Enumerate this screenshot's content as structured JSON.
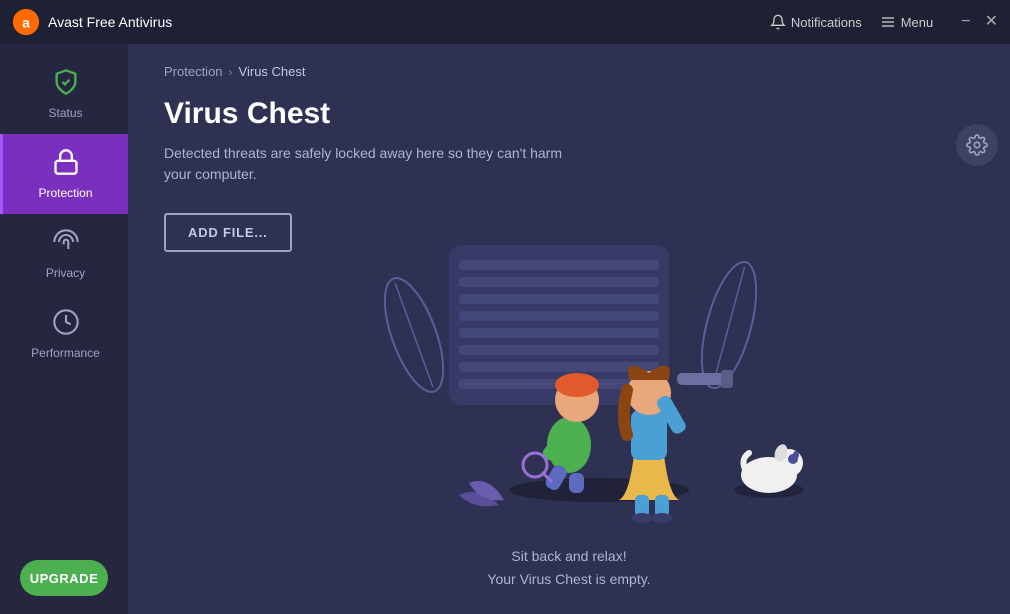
{
  "titleBar": {
    "appName": "Avast Free Antivirus",
    "notifications": "Notifications",
    "menu": "Menu",
    "minimize": "−",
    "close": "✕"
  },
  "sidebar": {
    "items": [
      {
        "id": "status",
        "label": "Status",
        "icon": "shield"
      },
      {
        "id": "protection",
        "label": "Protection",
        "icon": "lock",
        "active": true
      },
      {
        "id": "privacy",
        "label": "Privacy",
        "icon": "fingerprint"
      },
      {
        "id": "performance",
        "label": "Performance",
        "icon": "gauge"
      }
    ],
    "upgradeLabel": "UPGRADE"
  },
  "breadcrumb": {
    "parent": "Protection",
    "separator": "›",
    "current": "Virus Chest"
  },
  "main": {
    "title": "Virus Chest",
    "description": "Detected threats are safely locked away here so they can't harm your computer.",
    "addFileLabel": "ADD FILE...",
    "emptyLine1": "Sit back and relax!",
    "emptyLine2": "Your Virus Chest is empty."
  }
}
